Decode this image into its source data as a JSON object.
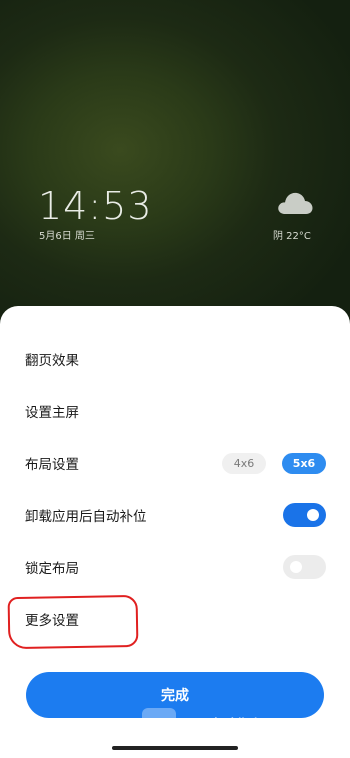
{
  "lockscreen": {
    "time": "14:53",
    "date": "5月6日 周三",
    "weather": "阴  22°C",
    "weather_icon": "cloud-icon"
  },
  "settings": {
    "rows": [
      {
        "label": "翻页效果"
      },
      {
        "label": "设置主屏"
      },
      {
        "label": "布局设置",
        "options": [
          "4x6",
          "5x6"
        ],
        "selected": "5x6"
      },
      {
        "label": "卸载应用后自动补位",
        "toggle": true
      },
      {
        "label": "锁定布局",
        "toggle": false
      },
      {
        "label": "更多设置"
      }
    ],
    "done_label": "完成"
  },
  "watermark": {
    "text": "一点排行网"
  },
  "colors": {
    "accent": "#1c7cf0",
    "annotation": "#e02020"
  }
}
